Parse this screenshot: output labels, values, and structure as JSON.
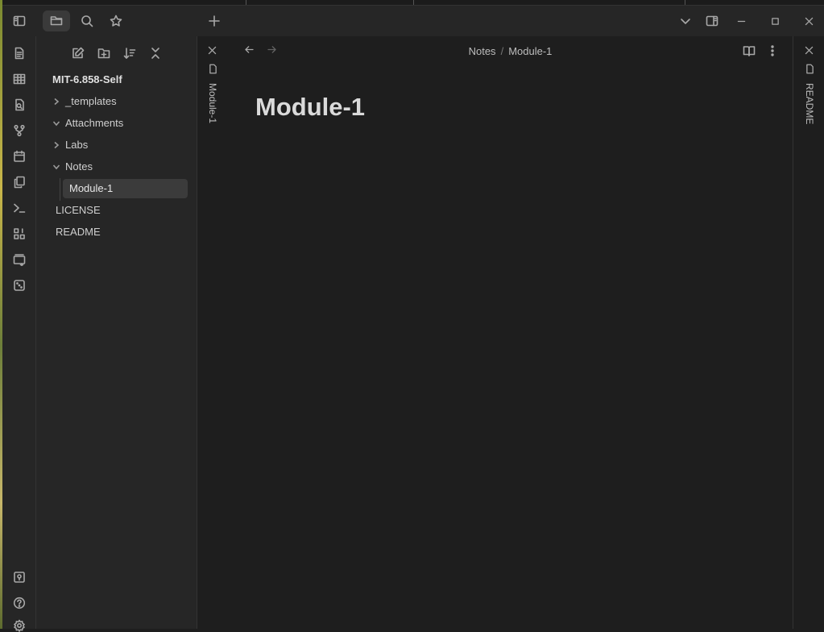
{
  "titlebar": {
    "new_tab_label": "+",
    "icons": [
      "sidebar-toggle-icon",
      "folder-icon",
      "search-icon",
      "star-icon",
      "plus-icon",
      "chevron-down-icon",
      "right-sidebar-icon",
      "minimize-icon",
      "maximize-icon",
      "close-icon"
    ]
  },
  "ribbon": {
    "icons": [
      "file-text-icon",
      "table-icon",
      "file-search-icon",
      "git-fork-icon",
      "calendar-icon",
      "copy-icon",
      "terminal-icon",
      "blocks-icon",
      "kanban-plus-icon",
      "dice-icon",
      "vault-switcher-icon",
      "help-icon",
      "settings-icon"
    ]
  },
  "sidebar": {
    "actions": [
      "new-note-icon",
      "new-folder-icon",
      "sort-icon",
      "collapse-all-icon"
    ],
    "vault_name": "MIT-6.858-Self",
    "tree": [
      {
        "label": "_templates",
        "type": "folder",
        "expanded": false
      },
      {
        "label": "Attachments",
        "type": "folder",
        "expanded": true
      },
      {
        "label": "Labs",
        "type": "folder",
        "expanded": false
      },
      {
        "label": "Notes",
        "type": "folder",
        "expanded": true
      },
      {
        "label": "Module-1",
        "type": "file",
        "active": true
      },
      {
        "label": "LICENSE",
        "type": "file"
      },
      {
        "label": "README",
        "type": "file"
      }
    ]
  },
  "left_stack": {
    "tab_label": "Module-1"
  },
  "editor": {
    "breadcrumb": {
      "folder": "Notes",
      "separator": "/",
      "file": "Module-1"
    },
    "title": "Module-1"
  },
  "right_stack": {
    "tab_label": "README"
  },
  "colors": {
    "background": "#1e1e1e",
    "panel": "#262626",
    "active_item": "#3b3b3b",
    "text": "#dadada"
  }
}
